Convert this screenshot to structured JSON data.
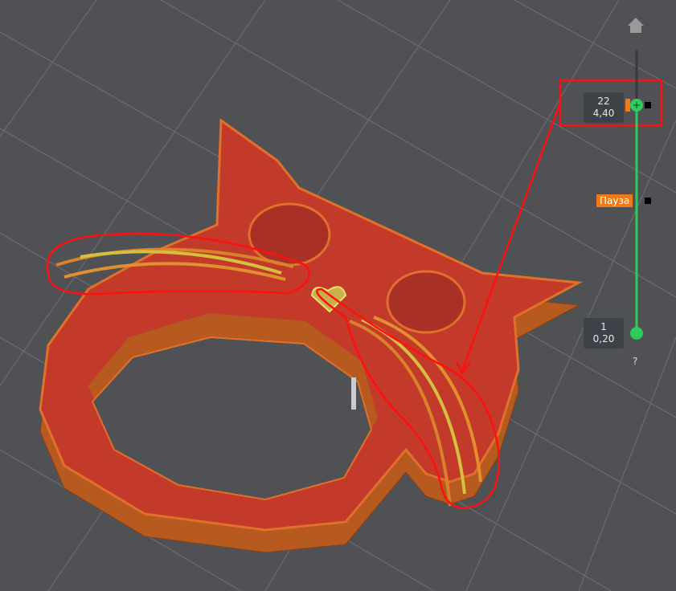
{
  "slider": {
    "upper": {
      "layer": "22",
      "height": "4,40"
    },
    "lower": {
      "layer": "1",
      "height": "0,20"
    },
    "pause_label": "Пауза",
    "help": "?"
  },
  "colors": {
    "background": "#505155",
    "slider_track": "#2ecc5a",
    "pause": "#f07a17",
    "model_top": "#c43a2a",
    "model_side": "#b65a1f",
    "annotation": "#ff1010"
  }
}
